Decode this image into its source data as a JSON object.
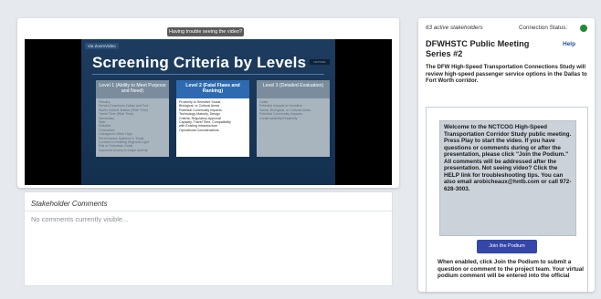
{
  "video_panel": {
    "trouble_button": "Having trouble seeing the video?",
    "slide": {
      "brand": "Via ZoomVideo",
      "brand_tag": "NCTCOG",
      "title": "Screening Criteria by Levels",
      "levels": [
        {
          "heading": "Level 1 (Ability to Meet Purpose and Need)",
          "items": [
            "Primary",
            "Serves Downtown Dallas and Fort",
            "Worth Central Station (Ride Time)",
            "Travel Time (Ride Time)",
            "",
            "Secondary",
            "Safe",
            "Reliable",
            "Connected",
            "Linkages to Other High",
            "Performance Systems in Texas",
            "Connect to Existing Regional Light",
            "Rail or Suburban Goals",
            "Improved Access to Major Activity",
            "Centers"
          ]
        },
        {
          "heading": "Level 2 (Fatal Flaws and Ranking)",
          "items": [
            "Proximity to Sensitive Social,",
            "Biological, or Cultural Areas",
            "Potential Community Impacts",
            "Technology Maturity, Design",
            "Criteria, Regulatory Approval",
            "Capacity, Travel Time, Compatibility",
            "with Existing Infrastructure",
            "Operational Considerations"
          ]
        },
        {
          "heading": "Level 3 (Detailed Evaluation)",
          "items": [
            "Costs",
            "Potential Impacts to Sensitive",
            "Social, Biological, or Cultural Areas",
            "Potential Community Impacts",
            "Constructability/Feasibility"
          ]
        }
      ]
    }
  },
  "comments": {
    "title": "Stakeholder Comments",
    "empty_text": "No comments currently visible..."
  },
  "sidebar": {
    "active_stakeholders": "63 active stakeholders",
    "connection_label": "Connection Status:",
    "connection_color": "#1f8a3a",
    "meeting_title": "DFWHSTC Public Meeting Series #2",
    "help": "Help",
    "intro": "The DFW High-Speed Transportation Connections Study will review high-speed passenger service options in the Dallas to Fort Worth corridor.",
    "welcome": "Welcome to the NCTCOG High-Speed Transportation Corridor Study public meeting. Press Play to start the video. If you have questions or comments during or after the presentation, please click \"Join the Podium.\" All comments will be addressed after the presentation. Not seeing video? Click the HELP link for troubleshooting tips. You can also email arobicheaux@hntb.com or call 972-628-3003.",
    "podium_button": "Join the Podium",
    "after_text": "When enabled, click Join the Podium to submit a question or comment to the project team. Your virtual podium comment will be entered into the official"
  }
}
